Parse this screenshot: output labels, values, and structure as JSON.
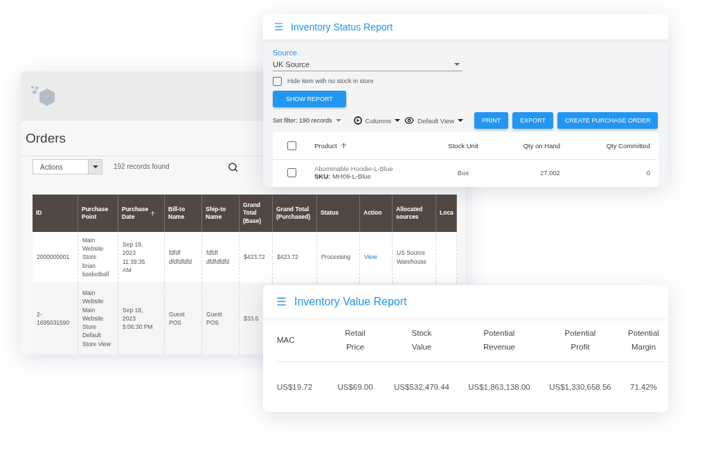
{
  "orders_window": {
    "title": "Orders",
    "actions_select": "Actions",
    "records": "192 records found",
    "columns": [
      {
        "label": "ID",
        "sorted": false
      },
      {
        "label": "Purchase\nPoint",
        "sorted": false
      },
      {
        "label": "Purchase\nDate",
        "sorted": true
      },
      {
        "label": "Bill-to\nName",
        "sorted": false
      },
      {
        "label": "Ship-to\nName",
        "sorted": false
      },
      {
        "label": "Grand\nTotal\n(Base)",
        "sorted": false
      },
      {
        "label": "Grand Total\n(Purchased)",
        "sorted": false
      },
      {
        "label": "Status",
        "sorted": false
      },
      {
        "label": "Action",
        "sorted": false
      },
      {
        "label": "Allocated\nsources",
        "sorted": false
      },
      {
        "label": "Loca",
        "sorted": false
      }
    ],
    "rows": [
      {
        "cells": [
          {
            "kind": "text",
            "text": "2000000001"
          },
          {
            "kind": "text",
            "text": "Main\nWebsite\nStore\nbrian\nbasketball"
          },
          {
            "kind": "text",
            "text": "Sep 19,\n2023\n11:39:35\nAM"
          },
          {
            "kind": "text",
            "text": "fdfdf\ndfdfdfdfd"
          },
          {
            "kind": "text",
            "text": "fdfdf\ndfdfdfdfd"
          },
          {
            "kind": "text",
            "text": "$423.72"
          },
          {
            "kind": "text",
            "text": "$423.72"
          },
          {
            "kind": "text",
            "text": "Processing"
          },
          {
            "kind": "link",
            "text": "View"
          },
          {
            "kind": "text",
            "text": "US Source\nWarehouse"
          }
        ]
      },
      {
        "cells": [
          {
            "kind": "text",
            "text": "2-\n1695031590"
          },
          {
            "kind": "text",
            "text": "Main\nWebsite\nMain\nWebsite\nStore\nDefault\nStore View"
          },
          {
            "kind": "text",
            "text": "Sep 18,\n2023\n5:06:30 PM"
          },
          {
            "kind": "text",
            "text": "Guest\nPOS"
          },
          {
            "kind": "text",
            "text": "Guest\nPOS"
          },
          {
            "kind": "text",
            "text": "$33.6"
          }
        ]
      }
    ]
  },
  "status_report": {
    "title": "Inventory Status Report",
    "source_label": "Source",
    "source_value": "UK Source",
    "hide_item": {
      "label": "Hide item with no stock in store",
      "checked": false
    },
    "show_button": "SHOW REPORT",
    "filter": "Set filter: 190 records",
    "columns_menu": "Columns",
    "view_menu": "Default View",
    "buttons": [
      "PRINT",
      "EXPORT",
      "CREATE PURCHASE ORDER"
    ],
    "table": {
      "all_checked": false,
      "columns": [
        {
          "label": "Product",
          "sorted": true
        },
        {
          "label": "Stock Unit",
          "sorted": false
        },
        {
          "label": "Qty on Hand",
          "sorted": false
        },
        {
          "label": "Qty Committed",
          "sorted": false
        }
      ],
      "rows": [
        {
          "product": "Abominable Hoodie-L-Blue",
          "sku_label": "SKU:",
          "sku": "MH09-L-Blue",
          "stock_unit": "Box",
          "qty_on_hand": "27,002",
          "qty_committed": "0",
          "selected": false
        }
      ]
    }
  },
  "value_report": {
    "title": "Inventory Value Report",
    "columns": [
      "MAC",
      "Retail\nPrice",
      "Stock\nValue",
      "Potential\nRevenue",
      "Potential\nProfit",
      "Potential\nMargin"
    ],
    "row": [
      "US$19.72",
      "US$69.00",
      "US$532,479.44",
      "US$1,863,138.00",
      "US$1,330,658.56",
      "71.42%"
    ]
  }
}
